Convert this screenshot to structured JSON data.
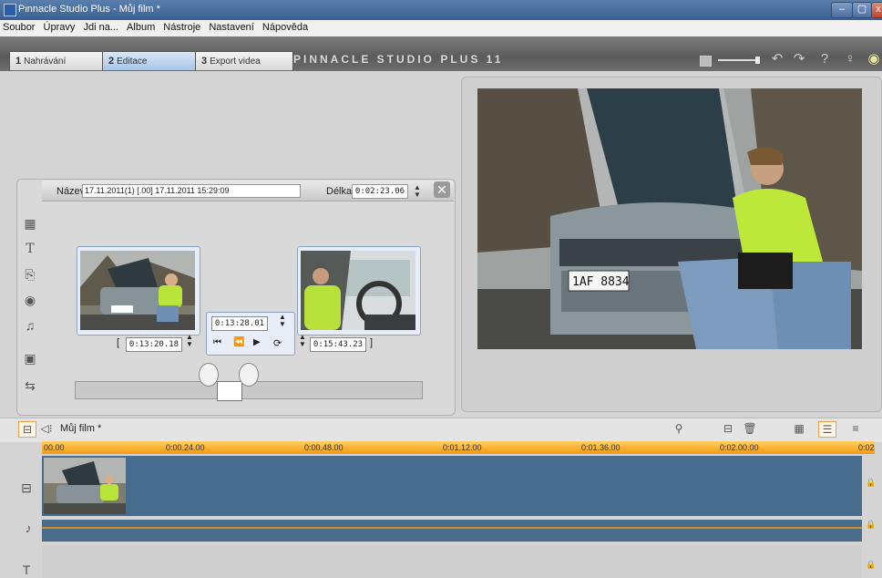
{
  "window": {
    "title": "Pinnacle Studio Plus - Můj film *",
    "minimize": "–",
    "maximize": "▢",
    "close": "x"
  },
  "menu": [
    "Soubor",
    "Úpravy",
    "Jdi na...",
    "Album",
    "Nástroje",
    "Nastavení",
    "Nápověda"
  ],
  "tabs": [
    {
      "num": "1",
      "label": "Nahrávání"
    },
    {
      "num": "2",
      "label": "Editace"
    },
    {
      "num": "3",
      "label": "Export videa"
    }
  ],
  "brand": "PINNACLE STUDIO PLUS 11",
  "toolbar_icons": [
    "undo-icon",
    "redo-icon",
    "help-icon",
    "hint-icon"
  ],
  "clip_editor": {
    "name_label": "Název",
    "name_value": "17.11.2011(1) [.00] 17.11.2011 15:29:09",
    "length_label": "Délka",
    "length_value": "0:02:23.06",
    "close": "✕",
    "in_time": "0:13:20.18",
    "current_time": "0:13:28.01",
    "out_time": "0:15:43.23",
    "transport": [
      "⏮",
      "⏪",
      "▶",
      "⟳"
    ],
    "in_bracket": "[",
    "out_bracket": "]"
  },
  "side_tools": [
    "T",
    "⎘",
    "◉",
    "♫",
    "▣",
    "⇆"
  ],
  "timeline": {
    "title": "Můj film *",
    "ruler": [
      "00.00",
      "0:00.24.00",
      "0:00.48.00",
      "0:01.12.00",
      "0:01.36.00",
      "0:02.00.00",
      "0:02"
    ]
  },
  "plate": "1AF 8834",
  "small_plate": "1AF 8834",
  "colors": {
    "accent_orange": "#f39a0f",
    "track_blue": "#486d8c",
    "active_tab": "#a8c6e6"
  }
}
